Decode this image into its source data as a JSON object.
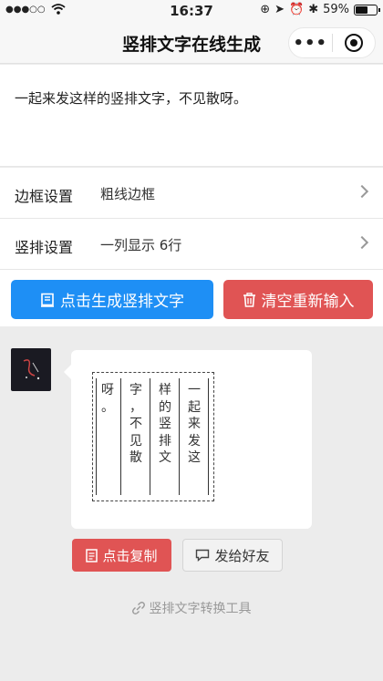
{
  "status": {
    "time": "16:37",
    "battery": "59%",
    "battery_level": 0.59
  },
  "nav": {
    "title": "竖排文字在线生成",
    "more_label": "•••"
  },
  "input": {
    "text": "一起来发这样的竖排文字，不见散呀。"
  },
  "settings": [
    {
      "label": "边框设置",
      "value": "粗线边框"
    },
    {
      "label": "竖排设置",
      "value": "一列显示 6行"
    }
  ],
  "buttons": {
    "generate": "点击生成竖排文字",
    "clear": "清空重新输入",
    "copy": "点击复制",
    "share": "发给好友"
  },
  "vertical_columns": [
    [
      "呀",
      "。",
      "",
      "",
      "",
      ""
    ],
    [
      "字",
      "，",
      "不",
      "见",
      "散",
      ""
    ],
    [
      "样",
      "的",
      "竖",
      "排",
      "文",
      ""
    ],
    [
      "一",
      "起",
      "来",
      "发",
      "这",
      ""
    ]
  ],
  "footer": {
    "text": "竖排文字转换工具"
  },
  "icons": {
    "wifi": "wifi-icon",
    "generate": "notebook-icon",
    "clear": "trash-icon",
    "copy": "document-icon",
    "share": "chat-bubble-icon",
    "footer": "link-icon"
  },
  "colors": {
    "primary_blue": "#1e8ff5",
    "danger_red": "#e05454"
  }
}
